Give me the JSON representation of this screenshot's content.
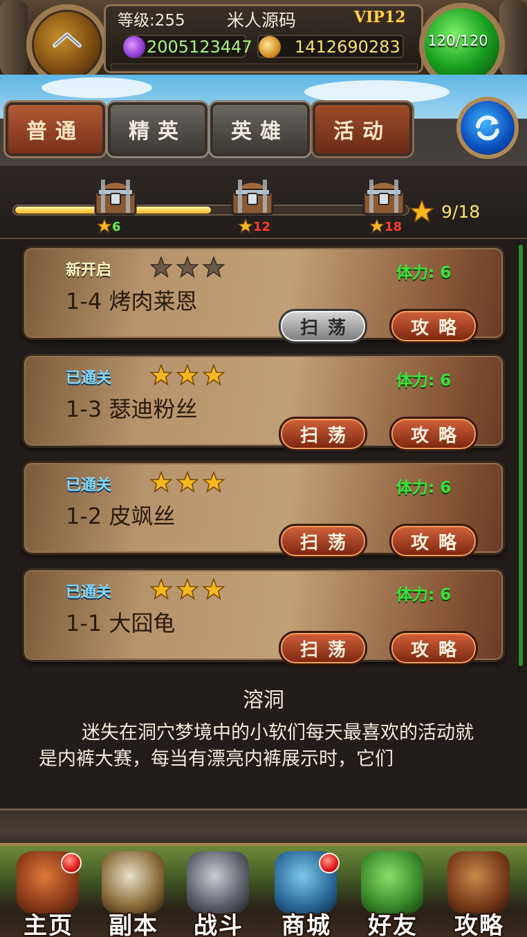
{
  "hud": {
    "level": "等级:255",
    "player_name": "米人源码",
    "vip": "VIP12",
    "gems": "2005123447",
    "gold": "1412690283",
    "stamina": "120/120"
  },
  "tabs": [
    {
      "label": "普通",
      "state": "active"
    },
    {
      "label": "精英",
      "state": "normal"
    },
    {
      "label": "英雄",
      "state": "normal"
    },
    {
      "label": "活动",
      "state": "normal"
    }
  ],
  "star_progress": {
    "earned": 9,
    "total": 18,
    "text": "9/18",
    "chests": [
      {
        "stars": "6",
        "color": "#5df24b"
      },
      {
        "stars": "12",
        "color": "#ff3a2e"
      },
      {
        "stars": "18",
        "color": "#ff3a2e"
      }
    ]
  },
  "stages": [
    {
      "status": "新开启",
      "status_type": "new",
      "stars_earned": 0,
      "stars_max": 3,
      "stamina": "体力: 6",
      "name": "1-4 烤肉莱恩",
      "sweep_label": "扫荡",
      "sweep_enabled": false,
      "guide_label": "攻略"
    },
    {
      "status": "已通关",
      "status_type": "cleared",
      "stars_earned": 3,
      "stars_max": 3,
      "stamina": "体力: 6",
      "name": "1-3 瑟迪粉丝",
      "sweep_label": "扫荡",
      "sweep_enabled": true,
      "guide_label": "攻略"
    },
    {
      "status": "已通关",
      "status_type": "cleared",
      "stars_earned": 3,
      "stars_max": 3,
      "stamina": "体力: 6",
      "name": "1-2 皮飒丝",
      "sweep_label": "扫荡",
      "sweep_enabled": true,
      "guide_label": "攻略"
    },
    {
      "status": "已通关",
      "status_type": "cleared",
      "stars_earned": 3,
      "stars_max": 3,
      "stamina": "体力: 6",
      "name": "1-1 大囧龟",
      "sweep_label": "扫荡",
      "sweep_enabled": true,
      "guide_label": "攻略"
    }
  ],
  "description": {
    "title": "溶洞",
    "body": "迷失在洞穴梦境中的小软们每天最喜欢的活动就是内裤大赛，每当有漂亮内裤展示时，它们"
  },
  "nav": [
    {
      "label": "主页",
      "icon": "house-icon",
      "badge": true
    },
    {
      "label": "副本",
      "icon": "skull-icon",
      "badge": false
    },
    {
      "label": "战斗",
      "icon": "sword-icon",
      "badge": false
    },
    {
      "label": "商城",
      "icon": "shop-monster-icon",
      "badge": true
    },
    {
      "label": "好友",
      "icon": "friends-icon",
      "badge": false
    },
    {
      "label": "攻略",
      "icon": "guide-book-icon",
      "badge": false
    }
  ],
  "colors": {
    "stamina_text": "#37e23a",
    "cleared_status": "#7fd6ff",
    "star_gold": "#f5b820",
    "progress_fill": "#f2b91c"
  }
}
